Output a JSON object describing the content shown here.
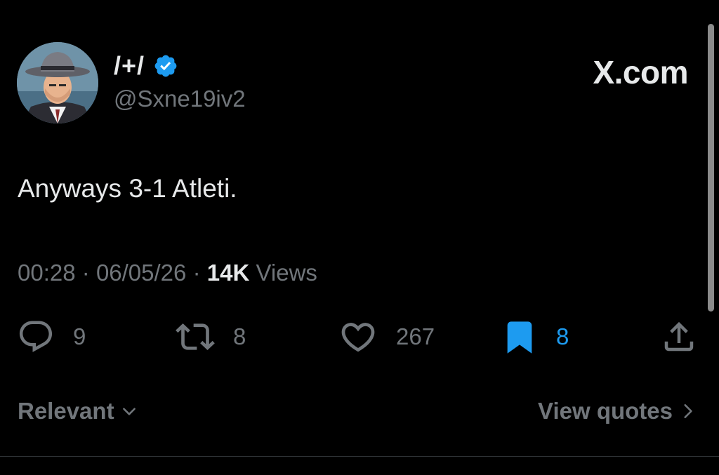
{
  "author": {
    "display_name": "/+/",
    "handle": "@Sxne19iv2",
    "verified": true,
    "avatar_icon": "fedora-man-avatar"
  },
  "brand": "X.com",
  "tweet": {
    "text": "Anyways 3-1 Atleti."
  },
  "meta": {
    "time": "00:28",
    "separator": "·",
    "date": "06/05/26",
    "views_count": "14K",
    "views_label": "Views"
  },
  "actions": {
    "replies": "9",
    "reposts": "8",
    "likes": "267",
    "bookmarks": "8"
  },
  "footer": {
    "sort_label": "Relevant",
    "view_quotes_label": "View quotes"
  },
  "colors": {
    "background": "#000000",
    "text": "#e7e9ea",
    "muted": "#71767b",
    "accent": "#1d9bf0"
  }
}
